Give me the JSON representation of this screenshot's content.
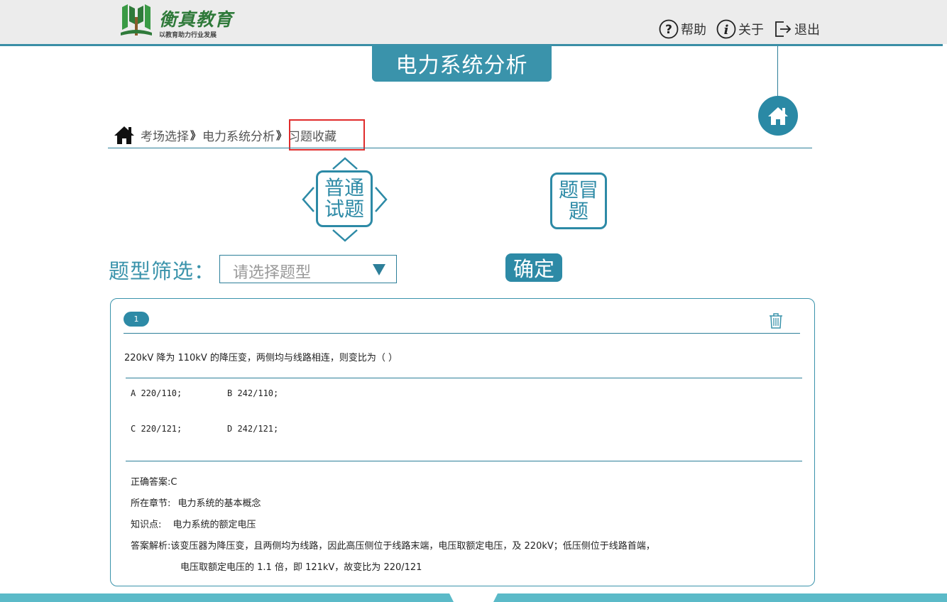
{
  "header": {
    "logo": {
      "name": "衡真教育",
      "slogan": "以教育助力行业发展",
      "brand_color": "#2f7a3a",
      "icon": "tree-book-icon"
    },
    "links": [
      {
        "label": "帮助",
        "icon": "help-icon"
      },
      {
        "label": "关于",
        "icon": "info-icon"
      },
      {
        "label": "退出",
        "icon": "logout-icon"
      }
    ]
  },
  "page_title": "电力系统分析",
  "home_button": {
    "icon": "home-icon"
  },
  "breadcrumb": {
    "home_icon": "home-icon",
    "separator": "》",
    "items": [
      "考场选择",
      "电力系统分析",
      "习题收藏"
    ]
  },
  "question_types": [
    {
      "label_line1": "普通",
      "label_line2": "试题",
      "selected": true
    },
    {
      "label_line1": "题冒",
      "label_line2": "题",
      "selected": false
    }
  ],
  "filter": {
    "label": "题型筛选：",
    "placeholder": "请选择题型",
    "confirm": "确定"
  },
  "question": {
    "number": "1",
    "text": "220kV 降为 110kV 的降压变，两侧均与线路相连，则变比为（  ）",
    "options": [
      "A 220/110;",
      "B 242/110;",
      "C 220/121;",
      "D 242/121;"
    ],
    "answer_label": "正确答案",
    "answer_value": ":C",
    "chapter_label": "所在章节:",
    "chapter_value": "电力系统的基本概念",
    "knowledge_label": "知识点:",
    "knowledge_value": "电力系统的额定电压",
    "analysis_label": "答案解析:",
    "analysis_line1": "该变压器为降压变，且两侧均为线路，因此高压侧位于线路末端，电压取额定电压，及 220kV；低压侧位于线路首端，",
    "analysis_line2": "电压取额定电压的 1.1 倍，即 121kV，故变比为 220/121"
  },
  "colors": {
    "accent": "#2d8aa6",
    "bottom_bar": "#5bbac8",
    "highlight": "#e02b2b"
  }
}
